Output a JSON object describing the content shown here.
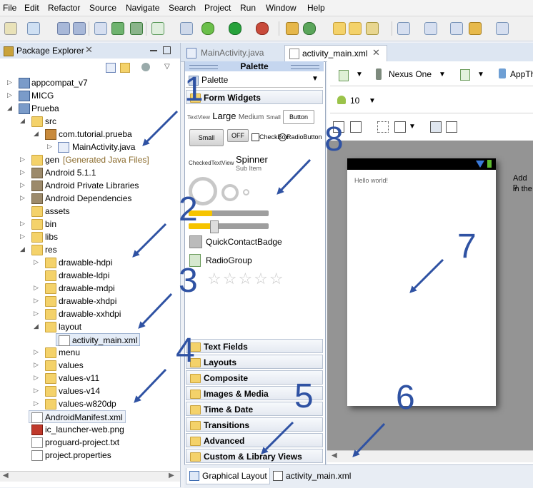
{
  "menu": [
    "File",
    "Edit",
    "Refactor",
    "Source",
    "Navigate",
    "Search",
    "Project",
    "Run",
    "Window",
    "Help"
  ],
  "package_explorer": {
    "title": "Package Explorer",
    "items": [
      {
        "label": "appcompat_v7",
        "suffix": ""
      },
      {
        "label": "MICG",
        "suffix": ""
      },
      {
        "label": "Prueba",
        "suffix": ""
      },
      {
        "label": "src",
        "suffix": ""
      },
      {
        "label": "com.tutorial.prueba",
        "suffix": ""
      },
      {
        "label": "MainActivity.java",
        "suffix": ""
      },
      {
        "label": "gen",
        "suffix": "[Generated Java Files]"
      },
      {
        "label": "Android 5.1.1",
        "suffix": ""
      },
      {
        "label": "Android Private Libraries",
        "suffix": ""
      },
      {
        "label": "Android Dependencies",
        "suffix": ""
      },
      {
        "label": "assets",
        "suffix": ""
      },
      {
        "label": "bin",
        "suffix": ""
      },
      {
        "label": "libs",
        "suffix": ""
      },
      {
        "label": "res",
        "suffix": ""
      },
      {
        "label": "drawable-hdpi",
        "suffix": ""
      },
      {
        "label": "drawable-ldpi",
        "suffix": ""
      },
      {
        "label": "drawable-mdpi",
        "suffix": ""
      },
      {
        "label": "drawable-xhdpi",
        "suffix": ""
      },
      {
        "label": "drawable-xxhdpi",
        "suffix": ""
      },
      {
        "label": "layout",
        "suffix": ""
      },
      {
        "label": "activity_main.xml",
        "suffix": ""
      },
      {
        "label": "menu",
        "suffix": ""
      },
      {
        "label": "values",
        "suffix": ""
      },
      {
        "label": "values-v11",
        "suffix": ""
      },
      {
        "label": "values-v14",
        "suffix": ""
      },
      {
        "label": "values-w820dp",
        "suffix": ""
      },
      {
        "label": "AndroidManifest.xml",
        "suffix": ""
      },
      {
        "label": "ic_launcher-web.png",
        "suffix": ""
      },
      {
        "label": "proguard-project.txt",
        "suffix": ""
      },
      {
        "label": "project.properties",
        "suffix": ""
      }
    ]
  },
  "editor_tabs": [
    "MainActivity.java",
    "activity_main.xml"
  ],
  "palette": {
    "header": "Palette",
    "select": "Palette",
    "form_widgets": "Form Widgets",
    "textview_sizes": [
      "TextView",
      "Large",
      "Medium",
      "Small"
    ],
    "button": "Button",
    "small_button": "Small",
    "toggle_off": "OFF",
    "checkbox": "CheckBox",
    "radiobutton": "RadioButton",
    "checked_textview": "CheckedTextView",
    "spinner": "Spinner",
    "spinner_sub": "Sub Item",
    "quick_contact": "QuickContactBadge",
    "radio_group": "RadioGroup",
    "categories": [
      "Text Fields",
      "Layouts",
      "Composite",
      "Images & Media",
      "Time & Date",
      "Transitions",
      "Advanced",
      "Custom & Library Views"
    ]
  },
  "layout_toolbar": {
    "device": "Nexus One",
    "theme": "AppTh",
    "api": "10"
  },
  "device_preview": {
    "hello": "Hello world!",
    "hint_line1": "Add p",
    "hint_line2": "in the"
  },
  "bottom_tabs": [
    "Graphical Layout",
    "activity_main.xml"
  ],
  "annotations": [
    "1",
    "2",
    "3",
    "4",
    "5",
    "6",
    "7",
    "8"
  ]
}
